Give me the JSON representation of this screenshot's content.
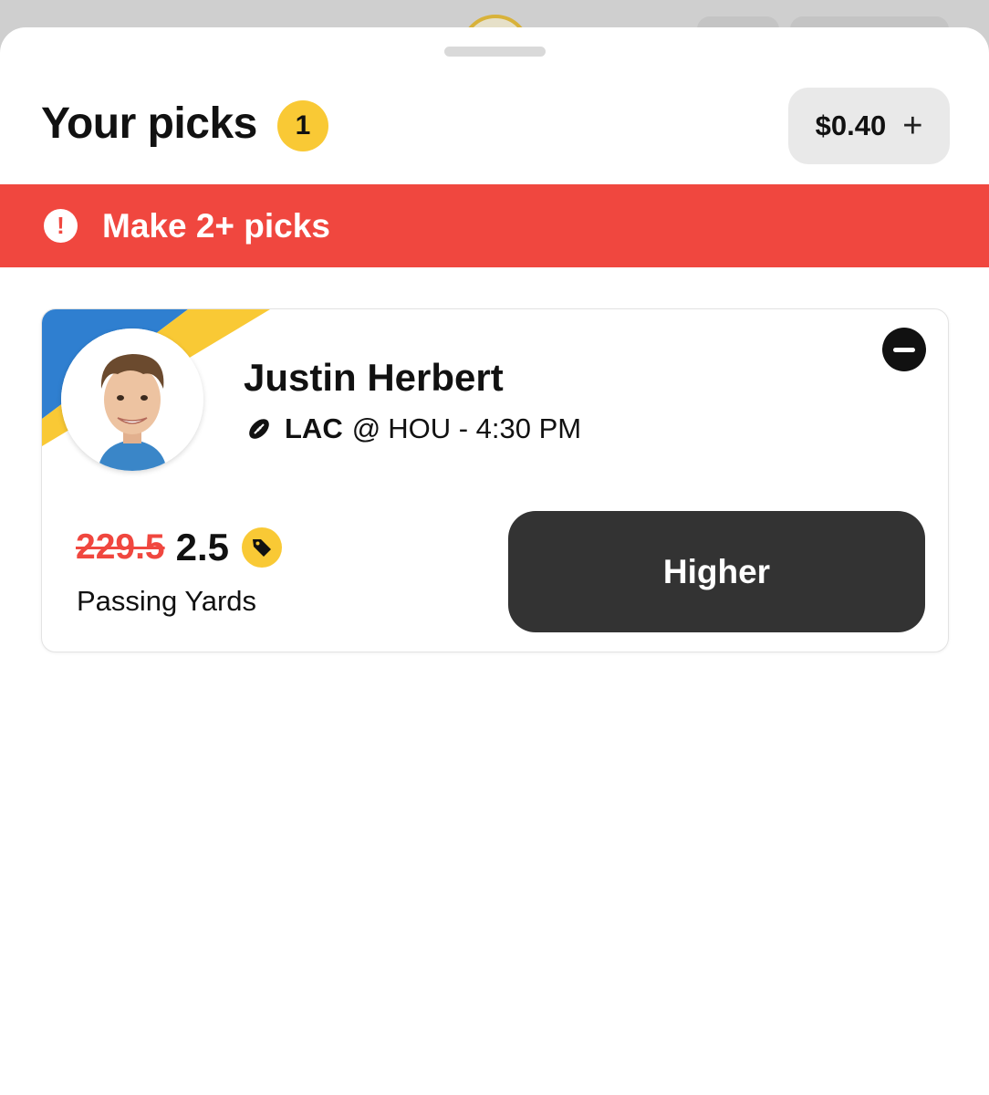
{
  "header": {
    "title": "Your picks",
    "pick_count": "1",
    "wallet_amount": "$0.40",
    "wallet_action": "+"
  },
  "alert": {
    "icon": "!",
    "message": "Make 2+ picks"
  },
  "pick": {
    "player_name": "Justin Herbert",
    "team": "LAC",
    "at": "@",
    "opponent_time": "HOU - 4:30 PM",
    "original_line": "229.5",
    "discounted_line": "2.5",
    "stat": "Passing Yards",
    "selection": "Higher",
    "sport_icon": "football-icon",
    "promo_icon": "tag-icon"
  },
  "colors": {
    "accent_yellow": "#f9c935",
    "alert_red": "#f0473f",
    "button_dark": "#333333",
    "team_blue": "#2f7fd0"
  }
}
